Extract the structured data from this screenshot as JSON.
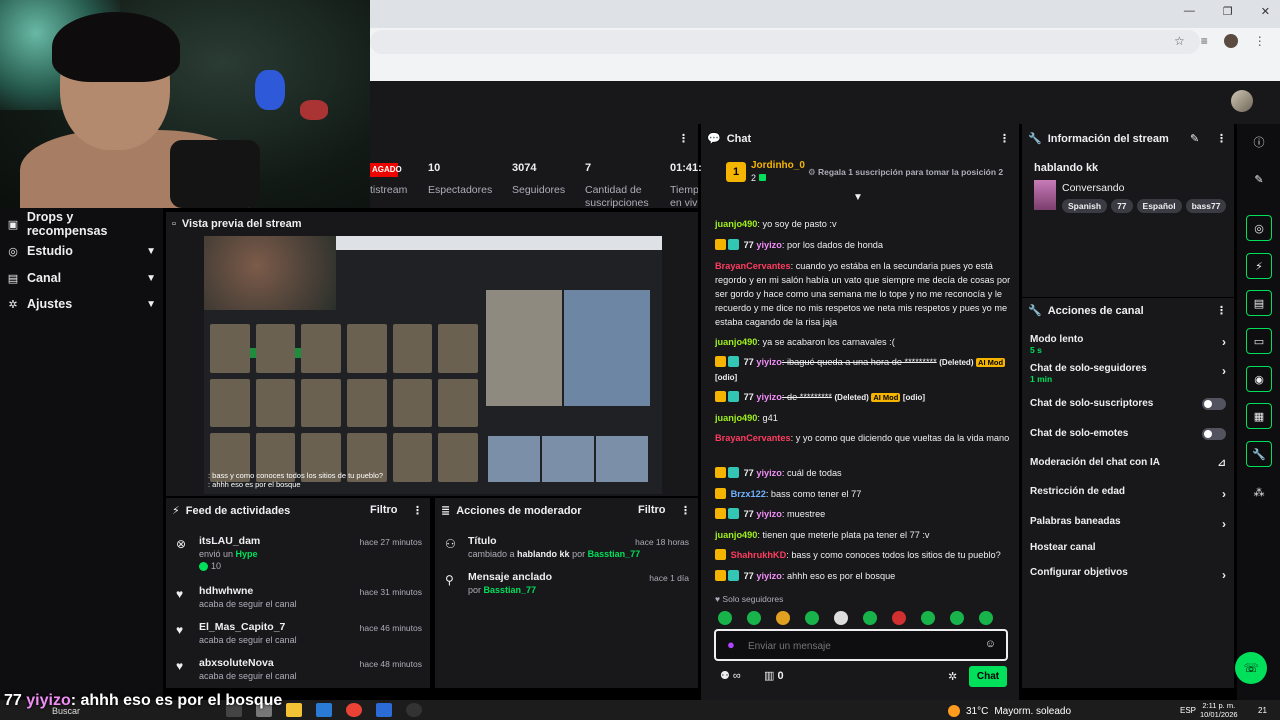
{
  "browser": {
    "minimize": "—",
    "restore": "❐",
    "close": "✕"
  },
  "nav": {
    "items": [
      {
        "label": "Drops y recompensas"
      },
      {
        "label": "Estudio"
      },
      {
        "label": "Canal"
      },
      {
        "label": "Ajustes"
      }
    ]
  },
  "stats": {
    "status_badge": "AGADO",
    "items": [
      {
        "value": "",
        "label": "tistream"
      },
      {
        "value": "10",
        "label": "Espectadores"
      },
      {
        "value": "3074",
        "label": "Seguidores"
      },
      {
        "value": "7",
        "label": "Cantidad de suscripciones"
      },
      {
        "value": "01:41:",
        "label": "Tiemp en viv"
      }
    ]
  },
  "preview": {
    "title": "Vista previa del stream",
    "caption_line1": ": bass y como conoces todos los sitios de tu pueblo?",
    "caption_line2": ": ahhh eso es por el bosque"
  },
  "feed": {
    "title": "Feed de actividades",
    "filter": "Filtro",
    "items": [
      {
        "name": "itsLAU_dam",
        "sub": "envió un",
        "hype": "Hype",
        "bits": "10",
        "time": "hace 27 minutos",
        "icon": "hype-icon"
      },
      {
        "name": "hdhwhwne",
        "sub": "acaba de seguir el canal",
        "time": "hace 31 minutos",
        "icon": "heart-icon"
      },
      {
        "name": "El_Mas_Capito_7",
        "sub": "acaba de seguir el canal",
        "time": "hace 46 minutos",
        "icon": "heart-icon"
      },
      {
        "name": "abxsoluteNova",
        "sub": "acaba de seguir el canal",
        "time": "hace 48 minutos",
        "icon": "heart-icon"
      }
    ]
  },
  "mod": {
    "title": "Acciones de moderador",
    "filter": "Filtro",
    "items": [
      {
        "name": "Título",
        "pre": "cambiado a",
        "value": "hablando kk",
        "by": "por",
        "user": "Basstian_77",
        "time": "hace 18 horas"
      },
      {
        "name": "Mensaje anclado",
        "pre": "",
        "value": "",
        "by": "por",
        "user": "Basstian_77",
        "time": "hace 1 día"
      }
    ]
  },
  "chat": {
    "title": "Chat",
    "top_rank": "1",
    "top_user": "Jordinho_0",
    "top_count": "2",
    "gift_text": "Regala 1 suscripción para tomar la posición 2",
    "followers_only": "Solo seguidores",
    "input_placeholder": "Enviar un mensaje",
    "points": "0",
    "send": "Chat",
    "deleted": "(Deleted)",
    "aimod": "AI Mod",
    "odio": "[odio]",
    "messages": [
      {
        "user": "juanjo490",
        "color": "#9ef01a",
        "text": ": yo soy de pasto :v"
      },
      {
        "user": "yiyizo",
        "color": "#f08ef6",
        "num": "77",
        "text": ": por los dados de honda"
      },
      {
        "user": "BrayanCervantes",
        "color": "#ff3c5f",
        "text": ": cuando yo estába en la secundaria pues yo está regordo y en mi salón había un vato que siempre me decía de cosas por ser gordo y hace como una semana me lo tope y no me reconocía y le recuerdo y me dice no mis respetos we neta mis respetos y pues yo me estaba cagando de la risa jaja"
      },
      {
        "user": "juanjo490",
        "color": "#9ef01a",
        "text": ": ya se acabaron los carnavales :("
      },
      {
        "user": "yiyizo",
        "color": "#f08ef6",
        "num": "77",
        "text": ": ibagué queda a una hora de *********"
      },
      {
        "user": "yiyizo",
        "color": "#f08ef6",
        "num": "77",
        "text": ": de *********"
      },
      {
        "user": "juanjo490",
        "color": "#9ef01a",
        "text": ": g41"
      },
      {
        "user": "BrayanCervantes",
        "color": "#ff3c5f",
        "text": ": y yo como que diciendo que vueltas da la vida mano"
      },
      {
        "user": "yiyizo",
        "color": "#f08ef6",
        "num": "77",
        "text": ": cuál de todas"
      },
      {
        "user": "Brzx122",
        "color": "#6eb2ff",
        "text": ": bass como tener el 77"
      },
      {
        "user": "yiyizo",
        "color": "#f08ef6",
        "num": "77",
        "text": ": muestree"
      },
      {
        "user": "juanjo490",
        "color": "#9ef01a",
        "text": ": tienen que meterle plata pa tener el 77 :v"
      },
      {
        "user": "ShahrukhKD",
        "color": "#ff3c5f",
        "text": ": bass y como conoces todos los sitios de tu pueblo?"
      },
      {
        "user": "yiyizo",
        "color": "#f08ef6",
        "num": "77",
        "text": ": ahhh eso es por el bosque"
      }
    ]
  },
  "info": {
    "title": "Información del stream",
    "stream_title": "hablando kk",
    "category": "Conversando",
    "tags": [
      "Spanish",
      "77",
      "Español",
      "bass77"
    ]
  },
  "actions": {
    "title": "Acciones de canal",
    "items": [
      {
        "label": "Modo lento",
        "sub": "5 s"
      },
      {
        "label": "Chat de solo-seguidores",
        "sub": "1 min"
      },
      {
        "label": "Chat de solo-suscriptores"
      },
      {
        "label": "Chat de solo-emotes"
      },
      {
        "label": "Moderación del chat con IA"
      },
      {
        "label": "Restricción de edad"
      },
      {
        "label": "Palabras baneadas"
      },
      {
        "label": "Hostear canal"
      },
      {
        "label": "Configurar objetivos"
      }
    ]
  },
  "overlay": {
    "num": "77",
    "user": "yiyizo",
    "text": ": ahhh eso es por el bosque"
  },
  "taskbar": {
    "search": "Buscar",
    "temp": "31°C",
    "weather": "Mayorm. soleado",
    "lang": "ESP",
    "time": "2:11 p. m.",
    "date": "10/01/2026",
    "notif": "21"
  },
  "colors": {
    "accent": "#00e05a",
    "panel": "#18181b",
    "background": "#0e0e10"
  }
}
